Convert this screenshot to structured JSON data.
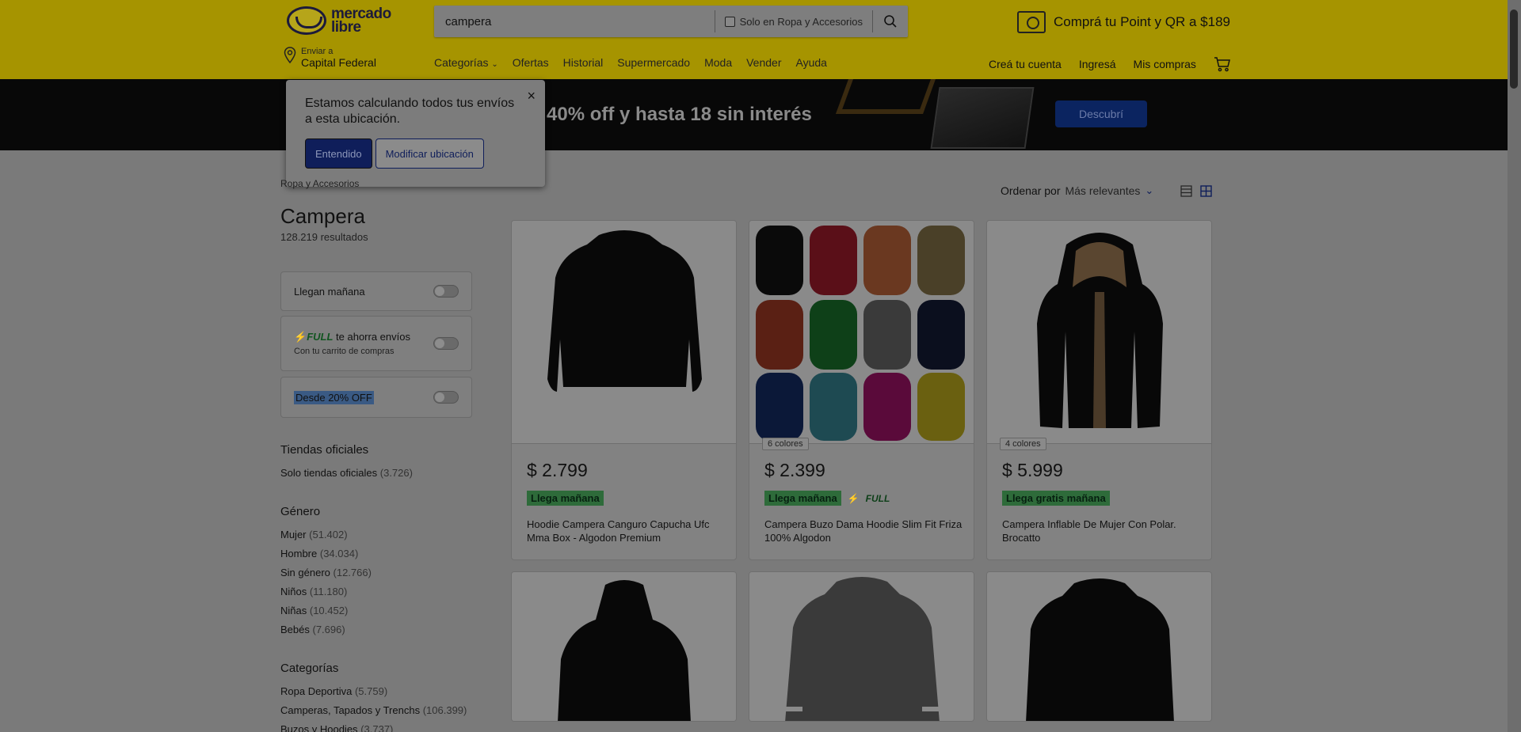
{
  "header": {
    "logo_line1": "mercado",
    "logo_line2": "libre",
    "search_value": "campera",
    "search_filter_label": "Solo en Ropa y Accesorios",
    "promo": "Comprá tu Point y QR a $189",
    "location_small": "Enviar a",
    "location_value": "Capital Federal",
    "nav": [
      "Categorías",
      "Ofertas",
      "Historial",
      "Supermercado",
      "Moda",
      "Vender",
      "Ayuda"
    ],
    "user_nav": [
      "Creá tu cuenta",
      "Ingresá",
      "Mis compras"
    ]
  },
  "banner": {
    "text": "a 40% off y hasta 18 sin interés",
    "button": "Descubrí"
  },
  "popover": {
    "message": "Estamos calculando todos tus envíos a esta ubicación.",
    "close": "×",
    "primary": "Entendido",
    "secondary": "Modificar ubicación"
  },
  "sidebar": {
    "breadcrumb": "Ropa y Accesorios",
    "title": "Campera",
    "results": "128.219 resultados",
    "filters": {
      "tomorrow": "Llegan mañana",
      "full_tag": "FULL",
      "full_label": "te ahorra envíos",
      "full_sub": "Con tu carrito de compras",
      "discount": "Desde 20% OFF"
    },
    "sections": [
      {
        "title": "Tiendas oficiales",
        "items": [
          {
            "label": "Solo tiendas oficiales",
            "count": "(3.726)"
          }
        ]
      },
      {
        "title": "Género",
        "items": [
          {
            "label": "Mujer",
            "count": "(51.402)"
          },
          {
            "label": "Hombre",
            "count": "(34.034)"
          },
          {
            "label": "Sin género",
            "count": "(12.766)"
          },
          {
            "label": "Niños",
            "count": "(11.180)"
          },
          {
            "label": "Niñas",
            "count": "(10.452)"
          },
          {
            "label": "Bebés",
            "count": "(7.696)"
          }
        ]
      },
      {
        "title": "Categorías",
        "items": [
          {
            "label": "Ropa Deportiva",
            "count": "(5.759)"
          },
          {
            "label": "Camperas, Tapados y Trenchs",
            "count": "(106.399)"
          },
          {
            "label": "Buzos y Hoodies",
            "count": "(3.737)"
          }
        ]
      }
    ]
  },
  "sort": {
    "label": "Ordenar por",
    "value": "Más relevantes"
  },
  "products": [
    {
      "price": "$ 2.799",
      "shipping": "Llega mañana",
      "full": "",
      "colors": "",
      "title": "Hoodie Campera Canguro Capucha Ufc Mma Box - Algodon Premium"
    },
    {
      "price": "$ 2.399",
      "shipping": "Llega mañana",
      "full": "FULL",
      "colors": "6 colores",
      "title": "Campera Buzo Dama Hoodie Slim Fit Friza 100% Algodon"
    },
    {
      "price": "$ 5.999",
      "shipping": "Llega gratis mañana",
      "full": "",
      "colors": "4 colores",
      "title": "Campera Inflable De Mujer Con Polar. Brocatto"
    }
  ],
  "colors": {
    "header_bg": "#a69400",
    "accent_blue": "#0f1e5a",
    "ship_green": "#2e6b3a"
  }
}
